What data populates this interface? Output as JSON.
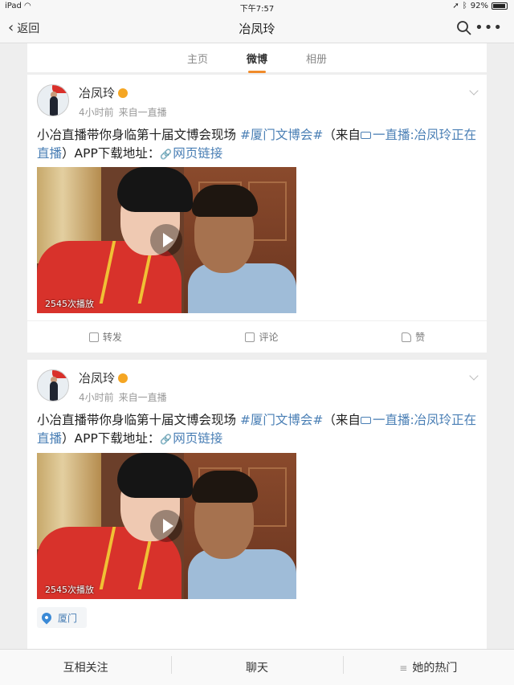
{
  "status_bar": {
    "device": "iPad",
    "time": "下午7:57",
    "battery": "92%"
  },
  "nav": {
    "back_label": "返回",
    "title": "冶凤玲"
  },
  "tabs": [
    {
      "label": "主页"
    },
    {
      "label": "微博"
    },
    {
      "label": "相册"
    }
  ],
  "posts": [
    {
      "author": "冶凤玲",
      "time": "4小时前",
      "source": "来自一直播",
      "text_prefix": "小冶直播带你身临第十届文博会现场 ",
      "hashtag": "#厦门文博会#",
      "text_mid": "（来自",
      "source_link": "一直播:冶凤玲正在直播",
      "text_suffix": "）APP下载地址：",
      "web_link": "网页链接",
      "play_count": "2545次播放",
      "actions": {
        "repost": "转发",
        "comment": "评论",
        "like": "赞"
      }
    },
    {
      "author": "冶凤玲",
      "time": "4小时前",
      "source": "来自一直播",
      "text_prefix": "小冶直播带你身临第十届文博会现场 ",
      "hashtag": "#厦门文博会#",
      "text_mid": "（来自",
      "source_link": "一直播:冶凤玲正在直播",
      "text_suffix": "）APP下载地址：",
      "web_link": "网页链接",
      "play_count": "2545次播放",
      "location": "厦门"
    }
  ],
  "bottom_bar": {
    "follow": "互相关注",
    "chat": "聊天",
    "hot": "她的热门"
  },
  "icons": [
    "wifi-icon",
    "location-arrow-icon",
    "bluetooth-icon",
    "battery-icon",
    "back-chevron-icon",
    "search-icon",
    "more-icon",
    "vip-icon",
    "chevron-down-icon",
    "link-icon",
    "video-icon",
    "play-icon",
    "repost-icon",
    "comment-icon",
    "like-icon",
    "location-pin-icon",
    "menu-icon"
  ],
  "colors": {
    "accent": "#f08b2b",
    "link": "#4a7fb5",
    "background": "#eeeeee"
  }
}
